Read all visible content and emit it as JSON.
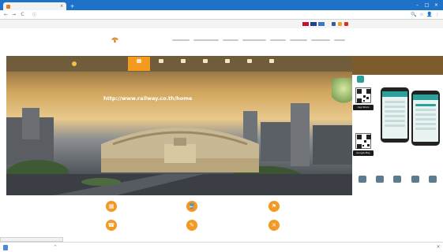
{
  "browser": {
    "tab_title": "",
    "url": "",
    "tab_close": "×",
    "new_tab": "+",
    "window": {
      "minimize": "–",
      "maximize": "□",
      "close": "×"
    },
    "nav": {
      "back": "←",
      "forward": "→",
      "reload": "C",
      "lock": "ⓘ"
    },
    "toolbar_right": {
      "zoom": "🔍",
      "star": "☆",
      "user": "👤",
      "menu": "⋮"
    }
  },
  "util_bar": {
    "links": "",
    "flags": [
      {
        "color": "#c8102e"
      },
      {
        "color": "#1f3f8f"
      },
      {
        "color": "#3a77c9"
      }
    ],
    "social": [
      {
        "color": "#3b5998"
      },
      {
        "color": "#f3a21b"
      },
      {
        "color": "#d93025"
      }
    ]
  },
  "header": {
    "logo_text": "",
    "menu_items": 8
  },
  "hero": {
    "strip_brand": "",
    "strip_nav": [
      {
        "label": "",
        "active": true
      },
      {
        "label": "",
        "active": false
      },
      {
        "label": "",
        "active": false
      },
      {
        "label": "",
        "active": false
      },
      {
        "label": "",
        "active": false
      },
      {
        "label": "",
        "active": false
      },
      {
        "label": "",
        "active": false
      }
    ],
    "banner_line1": "",
    "banner_line2_prefix": "",
    "banner_url": "http://www.railway.co.th/home",
    "caption": ""
  },
  "promo": {
    "title": "",
    "subtitle": "",
    "store_apple": "App Store",
    "store_google": "Google Play",
    "icons": [
      {
        "label": ""
      },
      {
        "label": ""
      },
      {
        "label": ""
      },
      {
        "label": ""
      },
      {
        "label": ""
      }
    ]
  },
  "services": [
    {
      "icon": "▦",
      "title": "",
      "subtitle": ""
    },
    {
      "icon": "🚆",
      "title": "",
      "subtitle": ""
    },
    {
      "icon": "⚑",
      "title": "",
      "subtitle": ""
    },
    {
      "icon": "☎",
      "title": "",
      "subtitle": ""
    },
    {
      "icon": "✎",
      "title": "",
      "subtitle": ""
    },
    {
      "icon": "✕",
      "title": "",
      "subtitle": ""
    }
  ],
  "status": {
    "url_hover": "",
    "download_file": "",
    "show_all": "",
    "close": "×"
  },
  "colors": {
    "chrome_blue": "#1e73c9",
    "accent_orange": "#f29a24",
    "promo_brown": "#7c5b2d",
    "teal": "#2aa29b"
  }
}
